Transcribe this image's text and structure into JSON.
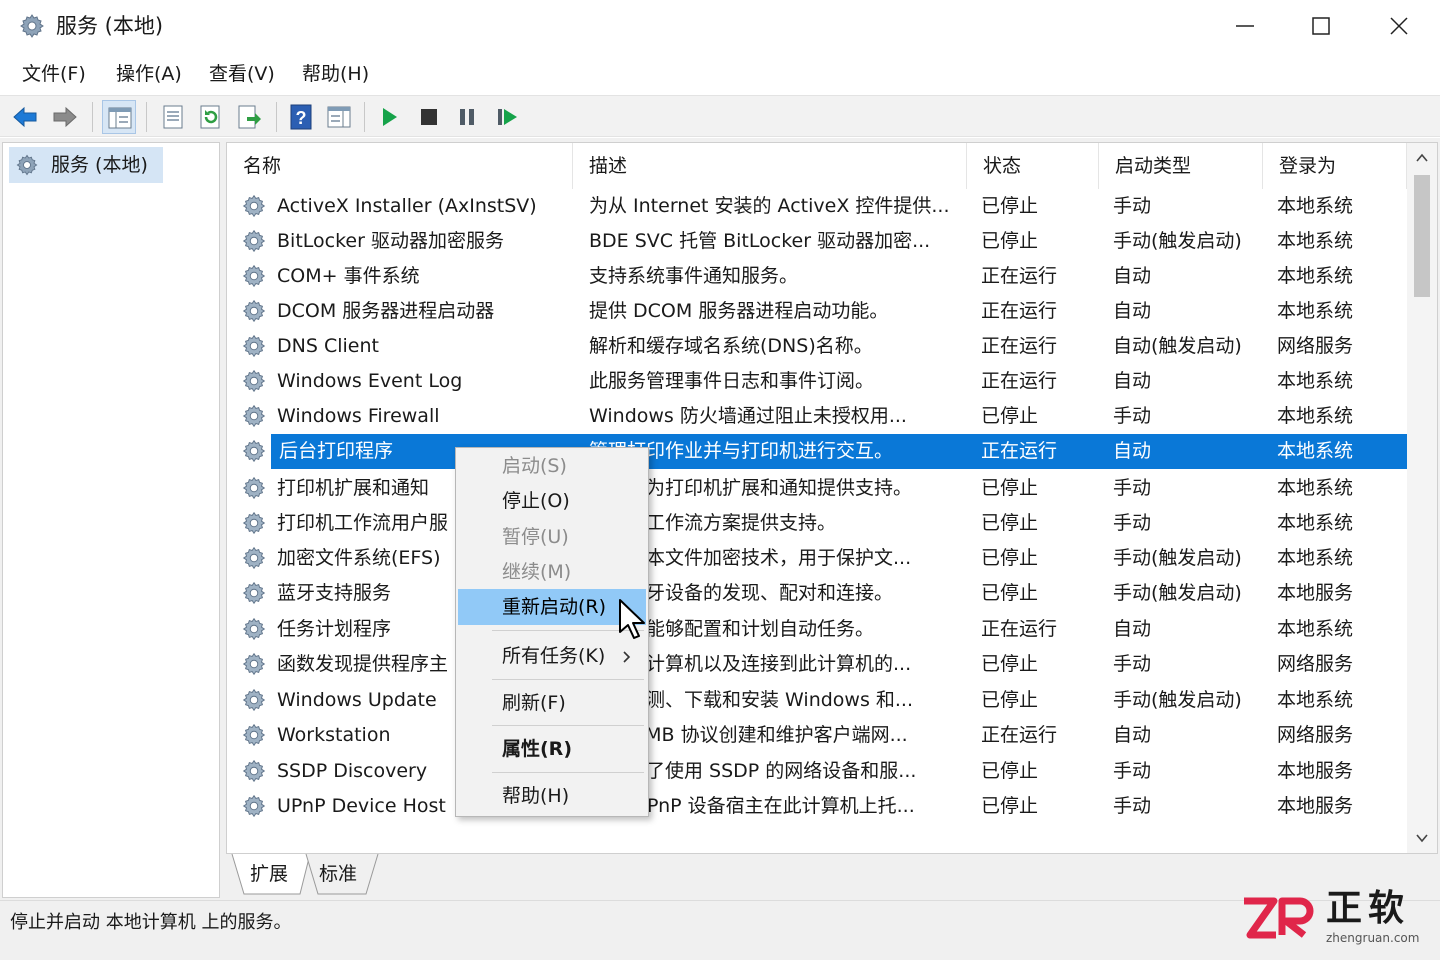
{
  "window": {
    "title": "服务 (本地)"
  },
  "menu": [
    "文件(F)",
    "操作(A)",
    "查看(V)",
    "帮助(H)"
  ],
  "tree": {
    "root_label": "服务 (本地)"
  },
  "columns": [
    "名称",
    "描述",
    "状态",
    "启动类型",
    "登录为"
  ],
  "services": [
    {
      "name": "ActiveX Installer (AxInstSV)",
      "desc": "为从 Internet 安装的 ActiveX 控件提供...",
      "status": "已停止",
      "startup": "手动",
      "logon": "本地系统"
    },
    {
      "name": "BitLocker 驱动器加密服务",
      "desc": "BDE SVC 托管 BitLocker 驱动器加密...",
      "status": "已停止",
      "startup": "手动(触发启动)",
      "logon": "本地系统"
    },
    {
      "name": "COM+ 事件系统",
      "desc": "支持系统事件通知服务。",
      "status": "正在运行",
      "startup": "自动",
      "logon": "本地系统"
    },
    {
      "name": "DCOM 服务器进程启动器",
      "desc": "提供 DCOM 服务器进程启动功能。",
      "status": "正在运行",
      "startup": "自动",
      "logon": "本地系统"
    },
    {
      "name": "DNS Client",
      "desc": "解析和缓存域名系统(DNS)名称。",
      "status": "正在运行",
      "startup": "自动(触发启动)",
      "logon": "网络服务"
    },
    {
      "name": "Windows Event Log",
      "desc": "此服务管理事件日志和事件订阅。",
      "status": "正在运行",
      "startup": "自动",
      "logon": "本地系统"
    },
    {
      "name": "Windows Firewall",
      "desc": "Windows 防火墙通过阻止未授权用...",
      "status": "已停止",
      "startup": "手动",
      "logon": "本地系统"
    },
    {
      "name": "后台打印程序",
      "desc": "管理打印作业并与打印机进行交互。",
      "status": "正在运行",
      "startup": "自动",
      "logon": "本地系统",
      "selected": true
    },
    {
      "name": "打印机扩展和通知",
      "desc": "此服务为打印机扩展和通知提供支持。",
      "status": "已停止",
      "startup": "手动",
      "logon": "本地系统"
    },
    {
      "name": "打印机工作流用户服",
      "desc": "为打印工作流方案提供支持。",
      "status": "已停止",
      "startup": "手动",
      "logon": "本地系统"
    },
    {
      "name": "加密文件系统(EFS)",
      "desc": "提供基本文件加密技术，用于保护文...",
      "status": "已停止",
      "startup": "手动(触发启动)",
      "logon": "本地系统"
    },
    {
      "name": "蓝牙支持服务",
      "desc": "支持蓝牙设备的发现、配对和连接。",
      "status": "已停止",
      "startup": "手动(触发启动)",
      "logon": "本地服务"
    },
    {
      "name": "任务计划程序",
      "desc": "使用户能够配置和计划自动任务。",
      "status": "正在运行",
      "startup": "自动",
      "logon": "本地系统"
    },
    {
      "name": "函数发现提供程序主",
      "desc": "发布此计算机以及连接到此计算机的...",
      "status": "已停止",
      "startup": "手动",
      "logon": "网络服务"
    },
    {
      "name": "Windows Update",
      "desc": "启用检测、下载和安装 Windows 和...",
      "status": "已停止",
      "startup": "手动(触发启动)",
      "logon": "本地系统"
    },
    {
      "name": "Workstation",
      "desc": "使用 SMB 协议创建和维护客户端网...",
      "status": "正在运行",
      "startup": "自动",
      "logon": "网络服务"
    },
    {
      "name": "SSDP Discovery",
      "desc": "当发现了使用 SSDP 的网络设备和服...",
      "status": "已停止",
      "startup": "手动",
      "logon": "本地服务"
    },
    {
      "name": "UPnP Device Host",
      "desc": "允许 UPnP 设备宿主在此计算机上托...",
      "status": "已停止",
      "startup": "手动",
      "logon": "本地服务"
    }
  ],
  "context_menu": {
    "start": "启动(S)",
    "stop": "停止(O)",
    "pause": "暂停(U)",
    "resume": "继续(M)",
    "restart": "重新启动(R)",
    "all_tasks": "所有任务(K)",
    "refresh": "刷新(F)",
    "properties": "属性(R)",
    "help": "帮助(H)"
  },
  "tabs": [
    "扩展",
    "标准"
  ],
  "status_text": "停止并启动 本地计算机 上的服务。",
  "watermark": {
    "brand_cn": "正软",
    "url": "zhengruan.com"
  },
  "colors": {
    "selection": "#0a78d7",
    "menu_highlight": "#91c9f7",
    "toolbar_bg": "#f2f2f2",
    "play_green": "#16a34a",
    "arrow_blue": "#1e7ad6",
    "watermark_red": "#e0264a"
  },
  "icons": {
    "app": "services-gear-icon",
    "back": "arrow-left-icon",
    "forward": "arrow-right-icon",
    "console_tree": "console-tree-icon",
    "export": "export-list-icon",
    "refresh": "refresh-icon",
    "help": "help-icon",
    "start": "play-icon",
    "stop": "stop-icon",
    "pause": "pause-icon",
    "restart": "restart-icon"
  }
}
